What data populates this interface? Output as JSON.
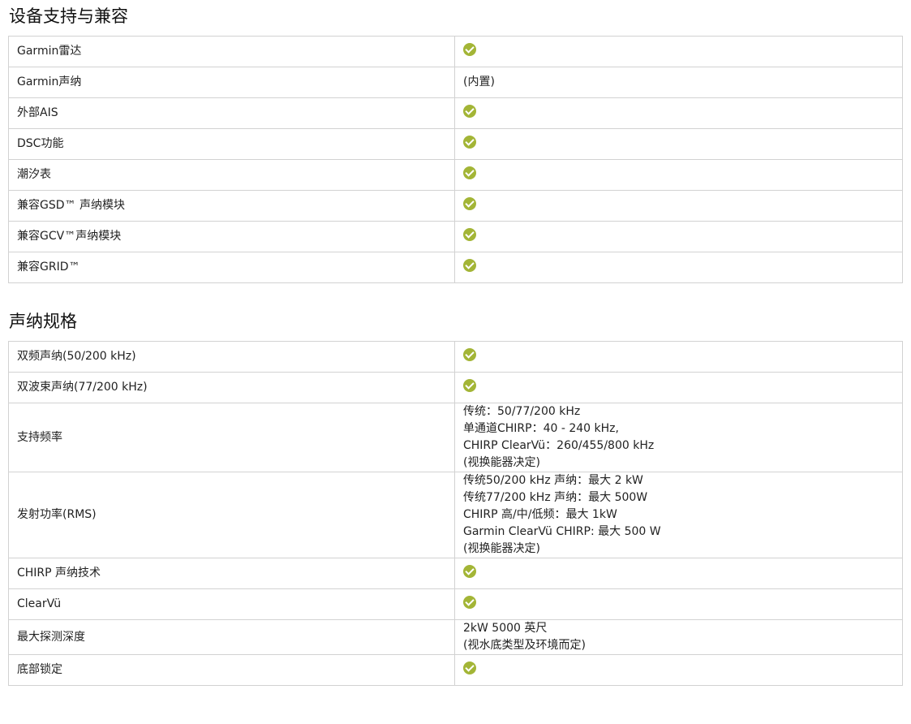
{
  "sections": [
    {
      "title": "设备支持与兼容",
      "rows": [
        {
          "label": "Garmin雷达",
          "value": "check"
        },
        {
          "label": "Garmin声纳",
          "value": "(内置)"
        },
        {
          "label": "外部AIS",
          "value": "check"
        },
        {
          "label": "DSC功能",
          "value": "check"
        },
        {
          "label": "潮汐表",
          "value": "check"
        },
        {
          "label": "兼容GSD™ 声纳模块",
          "value": "check"
        },
        {
          "label": "兼容GCV™声纳模块",
          "value": "check"
        },
        {
          "label": "兼容GRID™",
          "value": "check"
        }
      ]
    },
    {
      "title": "声纳规格",
      "rows": [
        {
          "label": "双频声纳(50/200 kHz)",
          "value": "check"
        },
        {
          "label": "双波束声纳(77/200 kHz)",
          "value": "check"
        },
        {
          "label": "支持频率",
          "lines": [
            "传统：50/77/200 kHz",
            "单通道CHIRP：40 - 240 kHz,",
            "CHIRP ClearVü：260/455/800 kHz",
            "(视换能器决定)"
          ]
        },
        {
          "label": "发射功率(RMS)",
          "lines": [
            "传统50/200 kHz 声纳：最大 2 kW",
            "传统77/200 kHz 声纳：最大 500W",
            "CHIRP 高/中/低频：最大 1kW",
            "Garmin ClearVü CHIRP: 最大 500 W",
            "(视换能器决定)"
          ]
        },
        {
          "label": "CHIRP 声纳技术",
          "value": "check"
        },
        {
          "label": "ClearVü",
          "value": "check"
        },
        {
          "label": "最大探测深度",
          "lines": [
            "2kW 5000 英尺",
            "(视水底类型及环境而定)"
          ]
        },
        {
          "label": "底部锁定",
          "value": "check"
        }
      ]
    }
  ],
  "colors": {
    "check": "#a3b536",
    "border": "#d2d2d2"
  }
}
